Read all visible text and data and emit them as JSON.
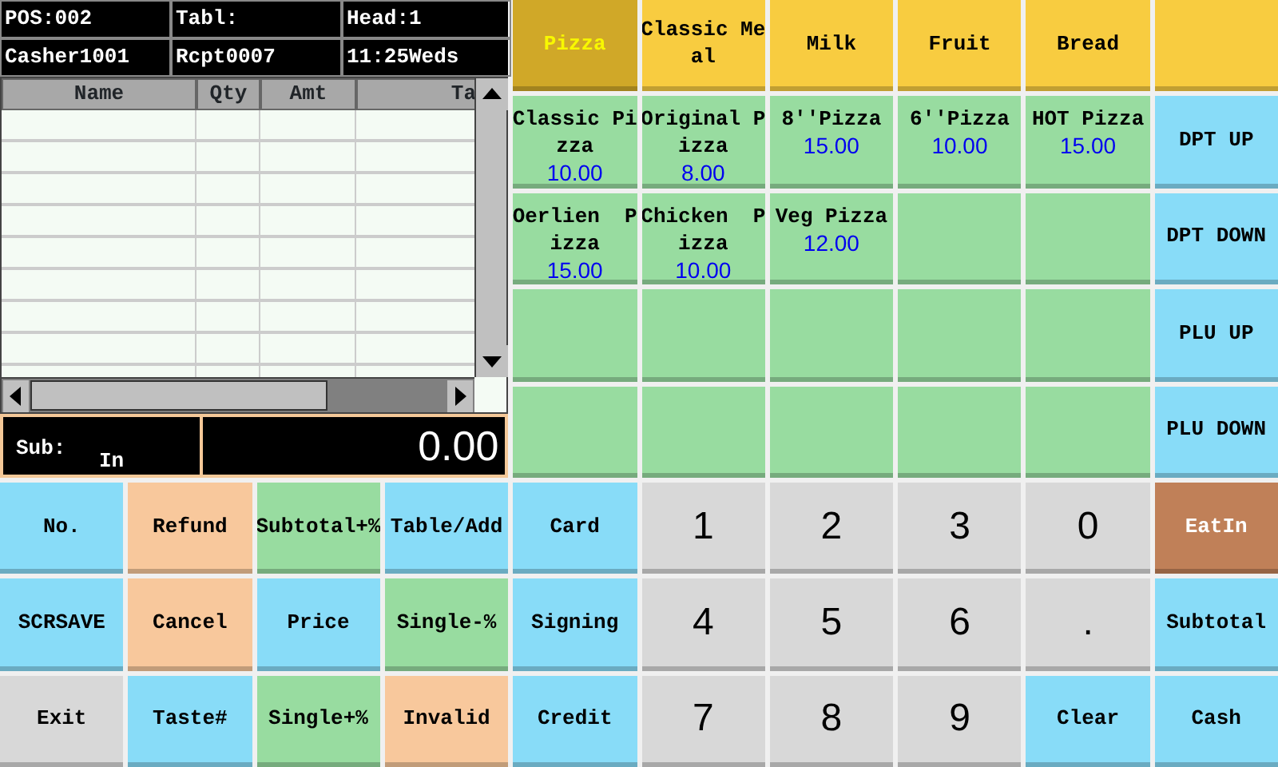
{
  "info": [
    {
      "label": "POS:002"
    },
    {
      "label": "Tabl:"
    },
    {
      "label": "Head:1"
    },
    {
      "label": "Casher1001"
    },
    {
      "label": "Rcpt0007"
    },
    {
      "label": "11:25Weds"
    }
  ],
  "table": {
    "columns": [
      "Name",
      "Qty",
      "Amt",
      "Ta"
    ]
  },
  "summary": {
    "label": "Sub:",
    "mode": "In",
    "total": "0.00"
  },
  "departments": [
    {
      "label": "Pizza",
      "selected": true
    },
    {
      "label": "Classic Meal",
      "selected": false
    },
    {
      "label": "Milk",
      "selected": false
    },
    {
      "label": "Fruit",
      "selected": false
    },
    {
      "label": "Bread",
      "selected": false
    }
  ],
  "items": [
    {
      "name": "Classic Pizza",
      "price": "10.00"
    },
    {
      "name": "Original Pizza",
      "price": "8.00"
    },
    {
      "name": "8''Pizza",
      "price": "15.00"
    },
    {
      "name": "6''Pizza",
      "price": "10.00"
    },
    {
      "name": "HOT Pizza",
      "price": "15.00"
    },
    {
      "name": "Oerlien  Pizza",
      "price": "15.00"
    },
    {
      "name": "Chicken  Pizza",
      "price": "10.00"
    },
    {
      "name": "Veg Pizza",
      "price": "12.00"
    }
  ],
  "nav_keys": [
    {
      "label": "DPT UP"
    },
    {
      "label": "DPT DOWN"
    },
    {
      "label": "PLU UP"
    },
    {
      "label": "PLU DOWN"
    }
  ],
  "keys": [
    {
      "label": "No.",
      "kind": "function",
      "color": "#88dcf8"
    },
    {
      "label": "Refund",
      "kind": "function",
      "color": "#f8c89c"
    },
    {
      "label": "Subtotal+%",
      "kind": "function",
      "color": "#98dca0"
    },
    {
      "label": "Table/Add",
      "kind": "function",
      "color": "#88dcf8"
    },
    {
      "label": "Card",
      "kind": "function",
      "color": "#88dcf8"
    },
    {
      "label": "1",
      "kind": "digit",
      "color": "#d8d8d8"
    },
    {
      "label": "2",
      "kind": "digit",
      "color": "#d8d8d8"
    },
    {
      "label": "3",
      "kind": "digit",
      "color": "#d8d8d8"
    },
    {
      "label": "0",
      "kind": "digit",
      "color": "#d8d8d8"
    },
    {
      "label": "EatIn",
      "kind": "accent",
      "color": "#c08058"
    },
    {
      "label": "SCRSAVE",
      "kind": "function",
      "color": "#88dcf8"
    },
    {
      "label": "Cancel",
      "kind": "function",
      "color": "#f8c89c"
    },
    {
      "label": "Price",
      "kind": "function",
      "color": "#88dcf8"
    },
    {
      "label": "Single-%",
      "kind": "function",
      "color": "#98dca0"
    },
    {
      "label": "Signing",
      "kind": "function",
      "color": "#88dcf8"
    },
    {
      "label": "4",
      "kind": "digit",
      "color": "#d8d8d8"
    },
    {
      "label": "5",
      "kind": "digit",
      "color": "#d8d8d8"
    },
    {
      "label": "6",
      "kind": "digit",
      "color": "#d8d8d8"
    },
    {
      "label": ".",
      "kind": "digit",
      "color": "#d8d8d8"
    },
    {
      "label": "Subtotal",
      "kind": "function",
      "color": "#88dcf8"
    },
    {
      "label": "Exit",
      "kind": "function",
      "color": "#d8d8d8"
    },
    {
      "label": "Taste#",
      "kind": "function",
      "color": "#88dcf8"
    },
    {
      "label": "Single+%",
      "kind": "function",
      "color": "#98dca0"
    },
    {
      "label": "Invalid",
      "kind": "function",
      "color": "#f8c89c"
    },
    {
      "label": "Credit",
      "kind": "function",
      "color": "#88dcf8"
    },
    {
      "label": "7",
      "kind": "digit",
      "color": "#d8d8d8"
    },
    {
      "label": "8",
      "kind": "digit",
      "color": "#d8d8d8"
    },
    {
      "label": "9",
      "kind": "digit",
      "color": "#d8d8d8"
    },
    {
      "label": "Clear",
      "kind": "function",
      "color": "#88dcf8"
    },
    {
      "label": "Cash",
      "kind": "function",
      "color": "#88dcf8"
    }
  ]
}
